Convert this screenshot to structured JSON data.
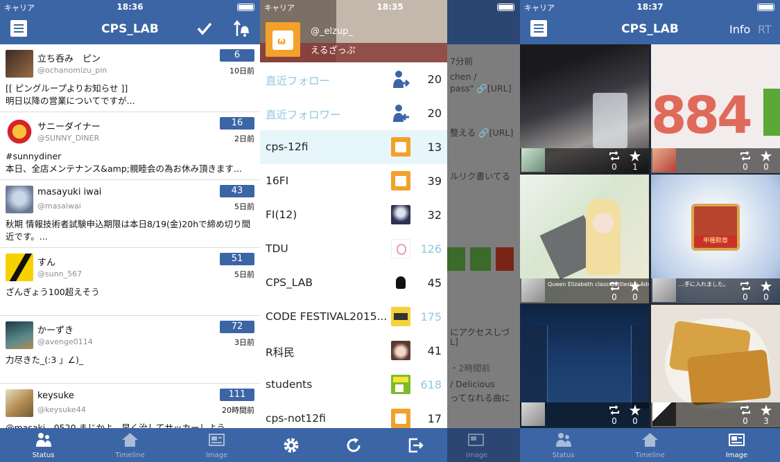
{
  "screen1": {
    "status": {
      "carrier": "キャリア",
      "time": "18:36"
    },
    "title": "CPS_LAB",
    "tweets": [
      {
        "name": "立ち呑み　ピン",
        "screen_name": "@ochanomizu_pin",
        "count": "6",
        "ago": "10日前",
        "body": "[[ ピングループよりお知らせ ]]\n明日以降の営業についてですが..."
      },
      {
        "name": "サニーダイナー",
        "screen_name": "@SUNNY_DINER",
        "count": "16",
        "ago": "2日前",
        "body": "#sunnydiner\n本日、全店メンテナンス&amp;親睦会の為お休み頂きます..."
      },
      {
        "name": "masayuki iwai",
        "screen_name": "@masaiwai",
        "count": "43",
        "ago": "5日前",
        "body": "秋期 情報技術者試験申込期限は本日8/19(金)20hで締め切り間近です。..."
      },
      {
        "name": "すん",
        "screen_name": "@sunn_567",
        "count": "51",
        "ago": "5日前",
        "body": "ざんぎょう100超えそう"
      },
      {
        "name": "かーずき",
        "screen_name": "@avenge0114",
        "count": "72",
        "ago": "3日前",
        "body": "力尽きた_(:3 」∠)_"
      },
      {
        "name": "keysuke",
        "screen_name": "@keysuke44",
        "count": "111",
        "ago": "20時間前",
        "body": "@masaki__0520 まじかよ、早く治してサッカーしよう"
      }
    ],
    "tabs": [
      "Status",
      "Timeline",
      "Image"
    ]
  },
  "screen2": {
    "status": {
      "carrier": "キャリア",
      "time": "18:35"
    },
    "user": {
      "screen_name": "@_elzup_",
      "display_name": "えるざっぷ"
    },
    "lists": [
      {
        "label": "直近フォロー",
        "count": "20",
        "label_blue": true,
        "count_blue": false,
        "icon": "user-follow-icon"
      },
      {
        "label": "直近フォロワー",
        "count": "20",
        "label_blue": true,
        "count_blue": false,
        "icon": "user-follower-icon"
      },
      {
        "label": "cps-12fi",
        "count": "13",
        "label_blue": false,
        "count_blue": false,
        "icon": "list-avatar-icon"
      },
      {
        "label": "16FI",
        "count": "39",
        "label_blue": false,
        "count_blue": false,
        "icon": "list-avatar-icon"
      },
      {
        "label": "FI(12)",
        "count": "32",
        "label_blue": false,
        "count_blue": false,
        "icon": "list-avatar-icon"
      },
      {
        "label": "TDU",
        "count": "126",
        "label_blue": false,
        "count_blue": true,
        "icon": "list-avatar-icon"
      },
      {
        "label": "CPS_LAB",
        "count": "45",
        "label_blue": false,
        "count_blue": false,
        "icon": "list-avatar-icon"
      },
      {
        "label": "CODE FESTIVAL2015...",
        "count": "175",
        "label_blue": false,
        "count_blue": true,
        "icon": "list-avatar-icon"
      },
      {
        "label": "R科民",
        "count": "41",
        "label_blue": false,
        "count_blue": false,
        "icon": "list-avatar-icon"
      },
      {
        "label": "students",
        "count": "618",
        "label_blue": false,
        "count_blue": true,
        "icon": "list-avatar-icon"
      },
      {
        "label": "cps-not12fi",
        "count": "17",
        "label_blue": false,
        "count_blue": false,
        "icon": "list-avatar-icon"
      }
    ],
    "behind": {
      "t1": "7分前",
      "t2": "chen /",
      "t3": "pass\" 🔗[URL]",
      "t4": "整える 🔗[URL]",
      "t5": "ルリク書いてる",
      "t6": "にアクセスしづ",
      "t7": "L]",
      "t8": "・2時間前",
      "t9": "/ Delicious",
      "t10": "ってなれる曲に",
      "tab": "Image"
    }
  },
  "screen3": {
    "status": {
      "carrier": "キャリア",
      "time": "18:37"
    },
    "title": "CPS_LAB",
    "info_label": "Info",
    "rt_label": "RT",
    "images": [
      {
        "rt": "0",
        "fav": "1"
      },
      {
        "rt": "0",
        "fav": "0"
      },
      {
        "rt": "0",
        "fav": "0",
        "caption": "Queen Elizabeth class Battleship Admiral……よろしく。私が…"
      },
      {
        "rt": "0",
        "fav": "0",
        "caption": "…手に入れました。"
      },
      {
        "rt": "0",
        "fav": "0"
      },
      {
        "rt": "0",
        "fav": "3"
      }
    ],
    "tabs": [
      "Status",
      "Timeline",
      "Image"
    ]
  },
  "colors": {
    "nav": "#3c65a5",
    "badge": "#3c65a5",
    "link_blue": "#8ec8e4",
    "selected_row": "#e6f6fb"
  }
}
